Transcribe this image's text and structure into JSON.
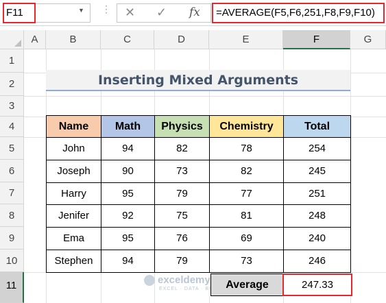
{
  "formula_bar": {
    "name_box": "F11",
    "cancel_icon": "close-icon",
    "enter_icon": "check-icon",
    "fx_label": "fx",
    "formula": "=AVERAGE(F5,F6,251,F8,F9,F10)"
  },
  "columns": [
    "A",
    "B",
    "C",
    "D",
    "E",
    "F",
    "G"
  ],
  "rows": [
    "1",
    "2",
    "3",
    "4",
    "5",
    "6",
    "7",
    "8",
    "9",
    "10",
    "11"
  ],
  "title": "Inserting Mixed Arguments",
  "table": {
    "headers": [
      "Name",
      "Math",
      "Physics",
      "Chemistry",
      "Total"
    ],
    "header_colors": [
      "#f8cbad",
      "#b4c6e7",
      "#c6e0b4",
      "#ffe699",
      "#bdd7ee"
    ],
    "rows": [
      [
        "John",
        "94",
        "82",
        "78",
        "254"
      ],
      [
        "Joseph",
        "90",
        "73",
        "82",
        "245"
      ],
      [
        "Harry",
        "95",
        "79",
        "77",
        "251"
      ],
      [
        "Jenifer",
        "92",
        "75",
        "81",
        "248"
      ],
      [
        "Ema",
        "95",
        "76",
        "69",
        "240"
      ],
      [
        "Stephen",
        "94",
        "79",
        "73",
        "246"
      ]
    ]
  },
  "average": {
    "label": "Average",
    "value": "247.33"
  },
  "watermark": {
    "name": "exceldemy",
    "tagline": "EXCEL · DATA · BI"
  },
  "accent_color": "#e8262c",
  "selection_color": "#217346"
}
